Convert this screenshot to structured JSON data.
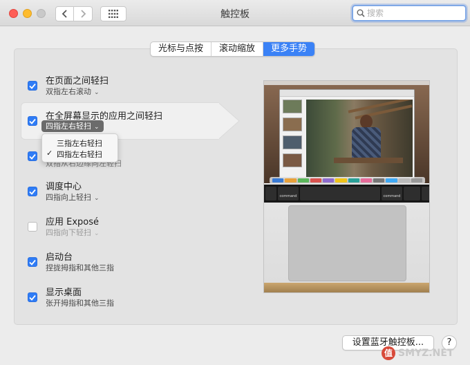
{
  "window": {
    "title": "触控板",
    "search_placeholder": "搜索"
  },
  "tabs": [
    {
      "label": "光标与点按",
      "active": false
    },
    {
      "label": "滚动缩放",
      "active": false
    },
    {
      "label": "更多手势",
      "active": true
    }
  ],
  "gestures": [
    {
      "title": "在页面之间轻扫",
      "value": "双指左右滚动",
      "checked": true
    },
    {
      "title": "在全屏幕显示的应用之间轻扫",
      "value": "四指左右轻扫",
      "checked": true
    },
    {
      "title": "",
      "value": "双指从右边缘向左轻扫",
      "checked": true
    },
    {
      "title": "调度中心",
      "value": "四指向上轻扫",
      "checked": true
    },
    {
      "title": "应用 Exposé",
      "value": "四指向下轻扫",
      "checked": false
    },
    {
      "title": "启动台",
      "value": "捏拢拇指和其他三指",
      "checked": true
    },
    {
      "title": "显示桌面",
      "value": "张开拇指和其他三指",
      "checked": true
    }
  ],
  "popup_menu": {
    "options": [
      "三指左右轻扫",
      "四指左右轻扫"
    ],
    "selected": "四指左右轻扫"
  },
  "preview": {
    "touchbar_key_label": "command"
  },
  "footer": {
    "bluetooth_button": "设置蓝牙触控板...",
    "help_label": "?"
  },
  "watermark": {
    "badge": "值",
    "text": "SMYZ.NET"
  },
  "colors": {
    "accent": "#3b82f6",
    "checkbox": "#2f7cf6",
    "close": "#fe5f57",
    "minimize": "#febc2e"
  }
}
